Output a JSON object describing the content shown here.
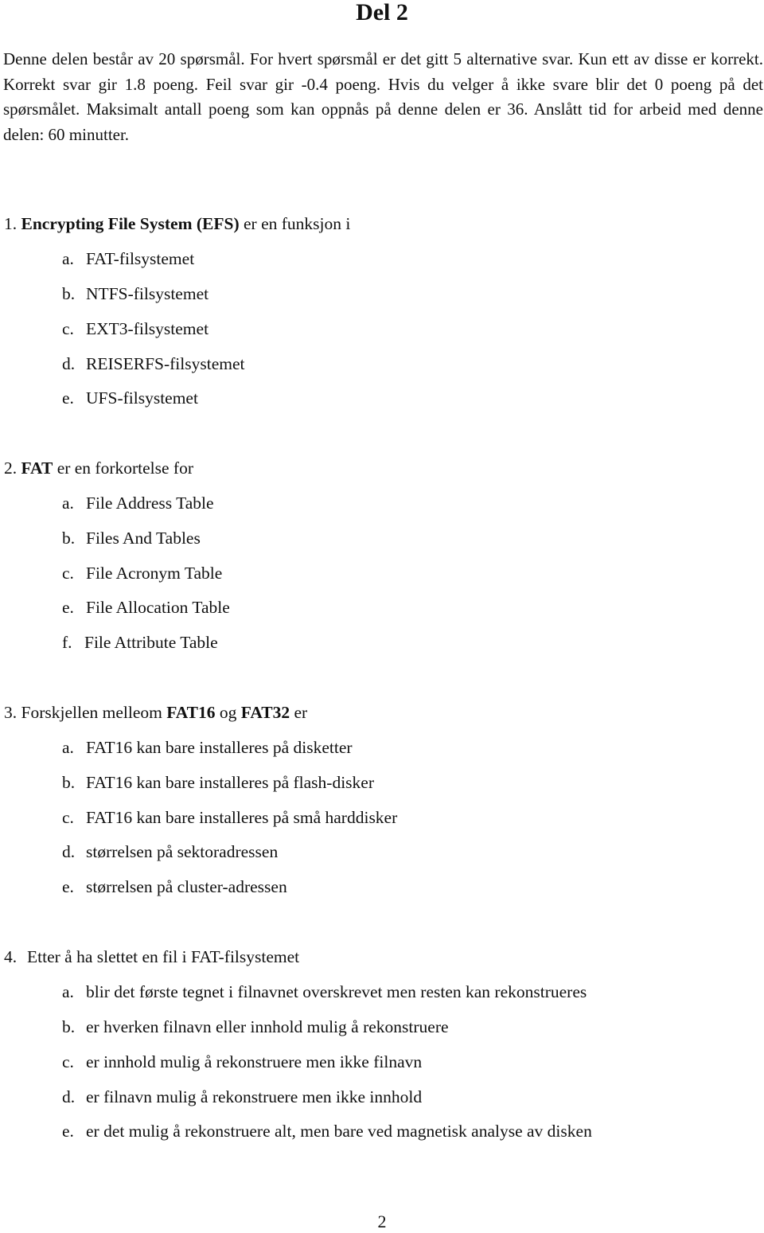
{
  "title": "Del 2",
  "intro": "Denne delen består av 20 spørsmål. For hvert spørsmål er det gitt 5 alternative svar. Kun ett av disse er korrekt. Korrekt svar gir 1.8 poeng. Feil svar gir -0.4 poeng. Hvis du velger å ikke svare blir det 0 poeng på det spørsmålet. Maksimalt antall poeng som kan oppnås på denne delen er 36. Anslått tid for arbeid med denne delen: 60 minutter.",
  "questions": [
    {
      "number": "1.",
      "bold": "Encrypting File System (EFS)",
      "rest": " er en funksjon i",
      "options": [
        {
          "label": "a.",
          "text": "FAT-filsystemet"
        },
        {
          "label": "b.",
          "text": "NTFS-filsystemet"
        },
        {
          "label": "c.",
          "text": "EXT3-filsystemet"
        },
        {
          "label": "d.",
          "text": "REISERFS-filsystemet"
        },
        {
          "label": "e.",
          "text": "UFS-filsystemet"
        }
      ]
    },
    {
      "number": "2.",
      "bold": "FAT",
      "rest": " er en forkortelse for",
      "options": [
        {
          "label": "a.",
          "text": "File Address Table"
        },
        {
          "label": "b.",
          "text": "Files And Tables"
        },
        {
          "label": "c.",
          "text": "File Acronym Table"
        },
        {
          "label": "e.",
          "text": "File Allocation Table"
        },
        {
          "label": "f.",
          "text": "File Attribute Table"
        }
      ]
    },
    {
      "number": "3.",
      "pre": " Forskjellen melleom ",
      "bold1": "FAT16",
      "mid": " og ",
      "bold2": "FAT32",
      "rest": " er",
      "options": [
        {
          "label": "a.",
          "text": "FAT16 kan bare installeres på disketter"
        },
        {
          "label": "b.",
          "text": "FAT16 kan bare installeres på flash-disker"
        },
        {
          "label": "c.",
          "text": "FAT16 kan bare installeres på små harddisker"
        },
        {
          "label": "d.",
          "text": "størrelsen på sektoradressen"
        },
        {
          "label": "e.",
          "text": "størrelsen på cluster-adressen"
        }
      ]
    },
    {
      "number": "4.",
      "text": "Etter å ha slettet en fil i FAT-filsystemet",
      "options": [
        {
          "label": "a.",
          "text": "blir det første tegnet i filnavnet overskrevet men resten kan rekonstrueres"
        },
        {
          "label": "b.",
          "text": "er hverken filnavn eller innhold mulig å rekonstruere"
        },
        {
          "label": "c.",
          "text": "er innhold mulig å rekonstruere men ikke filnavn"
        },
        {
          "label": "d.",
          "text": "er filnavn mulig å rekonstruere men ikke innhold"
        },
        {
          "label": "e.",
          "text": "er det mulig å rekonstruere alt, men bare ved magnetisk analyse av disken"
        }
      ]
    }
  ],
  "page_number": "2"
}
